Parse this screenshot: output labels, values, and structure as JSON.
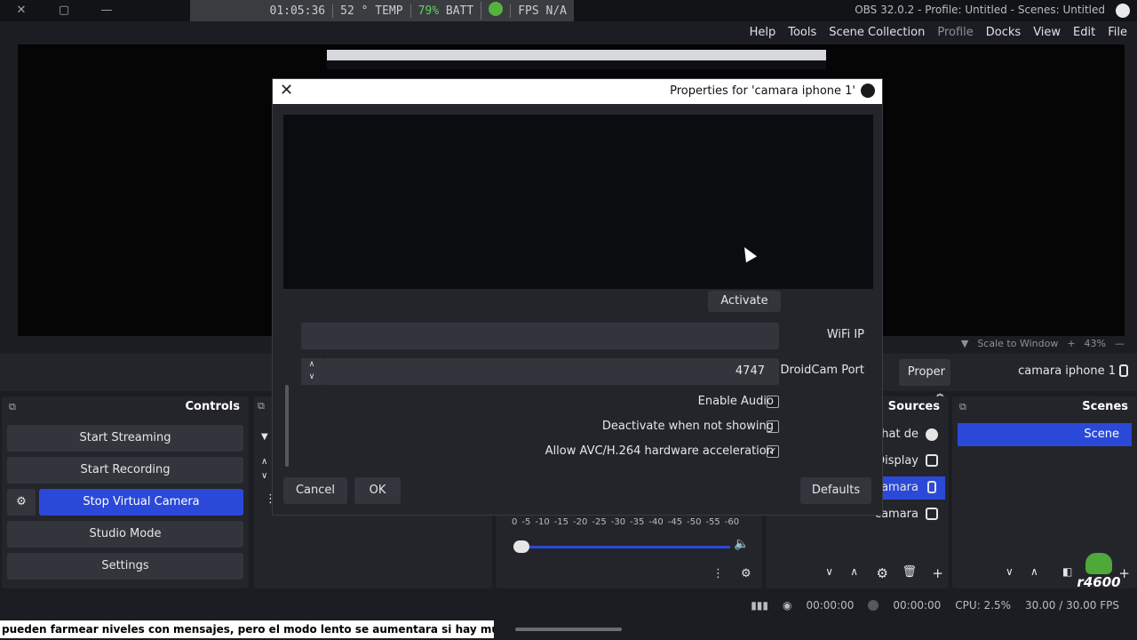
{
  "window": {
    "title": "OBS 32.0.2 - Profile: Untitled - Scenes: Untitled",
    "controls": [
      "✕",
      "▢",
      "—"
    ]
  },
  "overlay": {
    "fps": "FPS N/A",
    "batt": "BATT",
    "batt_val": "79%",
    "temp": "TEMP",
    "temp_val": "52 °",
    "time": "01:05:36"
  },
  "menu": [
    "File",
    "Edit",
    "View",
    "Docks",
    "Profile",
    "Scene Collection",
    "Tools",
    "Help"
  ],
  "preview_bar": {
    "zoom": "43%",
    "scale": "Scale to Window"
  },
  "scene_info": {
    "selected_source": "camara iphone 1",
    "properties_label": "Proper"
  },
  "dialog": {
    "title": "Properties for 'camara iphone 1'",
    "activate_label": "Activate",
    "wifi_label": "WiFi IP",
    "wifi_value": "",
    "port_label": "DroidCam Port",
    "port_value": "4747",
    "checkboxes": [
      {
        "label": "Enable Audio",
        "checked": false
      },
      {
        "label": "Deactivate when not showing",
        "checked": false
      },
      {
        "label": "Allow AVC/H.264 hardware acceleration",
        "checked": true
      }
    ],
    "defaults_label": "Defaults",
    "ok_label": "OK",
    "cancel_label": "Cancel"
  },
  "docks": {
    "scenes": {
      "title": "Scenes",
      "items": [
        "Scene"
      ]
    },
    "sources": {
      "title": "Sources",
      "items": [
        "chat de",
        "Display",
        "camara",
        "camara"
      ]
    },
    "controls": {
      "title": "Controls",
      "buttons": [
        "Start Streaming",
        "Start Recording",
        "Stop Virtual Camera",
        "Studio Mode",
        "Settings"
      ]
    },
    "mixer_ticks": [
      "-60",
      "-55",
      "-50",
      "-45",
      "-40",
      "-35",
      "-30",
      "-25",
      "-20",
      "-15",
      "-10",
      "-5",
      "0"
    ]
  },
  "status": {
    "stream_time": "00:00:00",
    "rec_time": "00:00:00",
    "cpu": "CPU: 2.5%",
    "fps": "30.00 / 30.00 FPS"
  },
  "ticker": "pueden farmear niveles con mensajes, pero el modo lento se aumentara si hay mucho spam",
  "badge": "r4600",
  "colors": {
    "accent": "#2b49d8",
    "bg": "#1c1d22",
    "panel": "#24252b"
  }
}
